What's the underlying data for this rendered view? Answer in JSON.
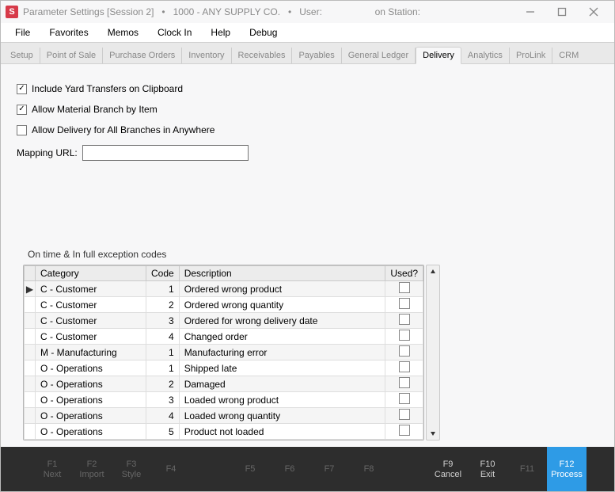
{
  "app_icon_letter": "S",
  "title": "Parameter Settings [Session 2]   •   1000 - ANY SUPPLY CO.   •   User:                    on Station:",
  "menu": [
    "File",
    "Favorites",
    "Memos",
    "Clock In",
    "Help",
    "Debug"
  ],
  "tabs": {
    "items": [
      "Setup",
      "Point of Sale",
      "Purchase Orders",
      "Inventory",
      "Receivables",
      "Payables",
      "General Ledger",
      "Delivery",
      "Analytics",
      "ProLink",
      "CRM"
    ],
    "active": "Delivery"
  },
  "form": {
    "include_yard": {
      "label": "Include Yard Transfers on Clipboard",
      "checked": true
    },
    "allow_branch": {
      "label": "Allow Material Branch by Item",
      "checked": true
    },
    "allow_delivery_all": {
      "label": "Allow Delivery for All Branches in Anywhere",
      "checked": false
    },
    "mapping_url_label": "Mapping URL:",
    "mapping_url_value": ""
  },
  "grid": {
    "title": "On time & In full exception codes",
    "headers": {
      "category": "Category",
      "code": "Code",
      "description": "Description",
      "used": "Used?"
    },
    "rows": [
      {
        "current": true,
        "category": "C - Customer",
        "code": "1",
        "description": "Ordered wrong product",
        "used": false
      },
      {
        "current": false,
        "category": "C - Customer",
        "code": "2",
        "description": "Ordered wrong quantity",
        "used": false
      },
      {
        "current": false,
        "category": "C - Customer",
        "code": "3",
        "description": "Ordered for wrong delivery date",
        "used": false
      },
      {
        "current": false,
        "category": "C - Customer",
        "code": "4",
        "description": "Changed order",
        "used": false
      },
      {
        "current": false,
        "category": "M - Manufacturing",
        "code": "1",
        "description": "Manufacturing error",
        "used": false
      },
      {
        "current": false,
        "category": "O - Operations",
        "code": "1",
        "description": "Shipped late",
        "used": false
      },
      {
        "current": false,
        "category": "O - Operations",
        "code": "2",
        "description": "Damaged",
        "used": false
      },
      {
        "current": false,
        "category": "O - Operations",
        "code": "3",
        "description": "Loaded wrong product",
        "used": false
      },
      {
        "current": false,
        "category": "O - Operations",
        "code": "4",
        "description": "Loaded wrong quantity",
        "used": false
      },
      {
        "current": false,
        "category": "O - Operations",
        "code": "5",
        "description": "Product not loaded",
        "used": false
      }
    ]
  },
  "footer": {
    "keys": [
      {
        "k": "F1",
        "lbl": "Next",
        "dim": true
      },
      {
        "k": "F2",
        "lbl": "Import",
        "dim": true
      },
      {
        "k": "F3",
        "lbl": "Style",
        "dim": true
      },
      {
        "k": "F4",
        "lbl": "",
        "dim": true
      },
      {
        "k": "",
        "lbl": ""
      },
      {
        "k": "F5",
        "lbl": "",
        "dim": true
      },
      {
        "k": "F6",
        "lbl": "",
        "dim": true
      },
      {
        "k": "F7",
        "lbl": "",
        "dim": true
      },
      {
        "k": "F8",
        "lbl": "",
        "dim": true
      },
      {
        "k": "",
        "lbl": ""
      },
      {
        "k": "F9",
        "lbl": "Cancel",
        "dim": false
      },
      {
        "k": "F10",
        "lbl": "Exit",
        "dim": false
      },
      {
        "k": "F11",
        "lbl": "",
        "dim": true
      },
      {
        "k": "F12",
        "lbl": "Process",
        "dim": false,
        "primary": true
      }
    ]
  }
}
